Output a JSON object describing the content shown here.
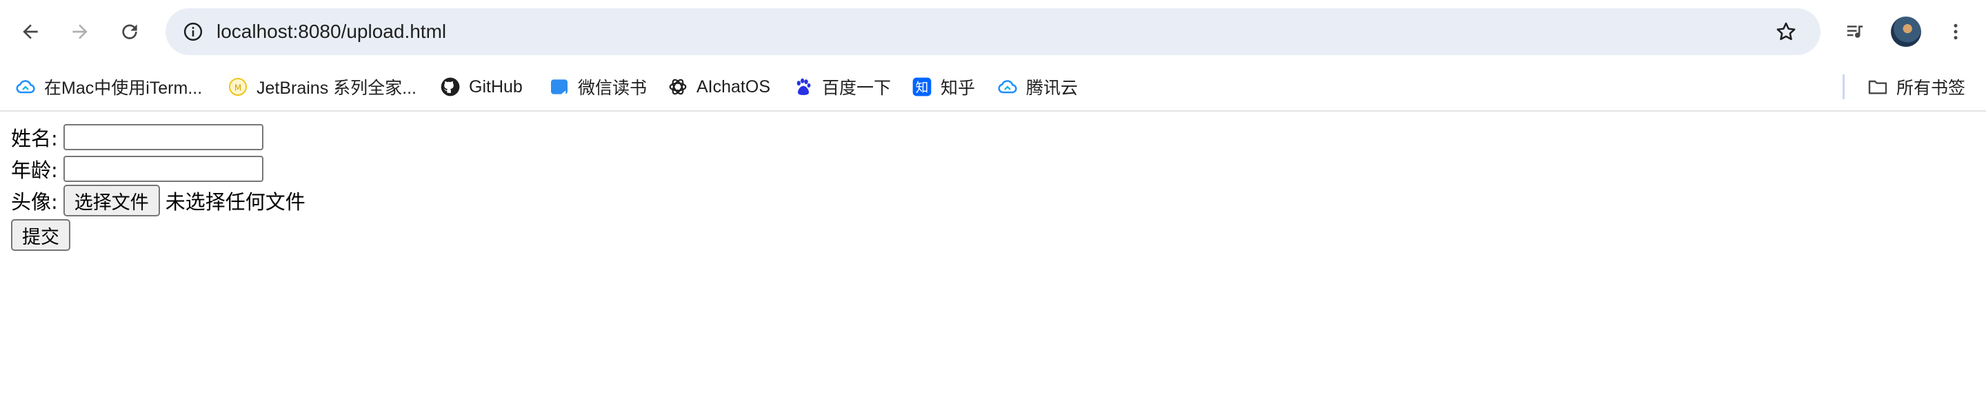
{
  "browser": {
    "address": "localhost:8080/upload.html"
  },
  "bookmarks": [
    {
      "label": "在Mac中使用iTerm...",
      "icon": "cloud-icon"
    },
    {
      "label": "JetBrains 系列全家...",
      "icon": "jetbrains-icon"
    },
    {
      "label": "GitHub",
      "icon": "github-icon"
    },
    {
      "label": "微信读书",
      "icon": "weread-icon"
    },
    {
      "label": "AIchatOS",
      "icon": "openai-icon"
    },
    {
      "label": "百度一下",
      "icon": "baidu-icon"
    },
    {
      "label": "知乎",
      "icon": "zhihu-icon"
    },
    {
      "label": "腾讯云",
      "icon": "tencent-cloud-icon"
    }
  ],
  "all_bookmarks_label": "所有书签",
  "form": {
    "name_label": "姓名:",
    "age_label": "年龄:",
    "avatar_label": "头像:",
    "file_button": "选择文件",
    "file_status": "未选择任何文件",
    "submit": "提交"
  },
  "colors": {
    "omnibox_bg": "#e9eef6",
    "accent_blue": "#1a73e8"
  }
}
